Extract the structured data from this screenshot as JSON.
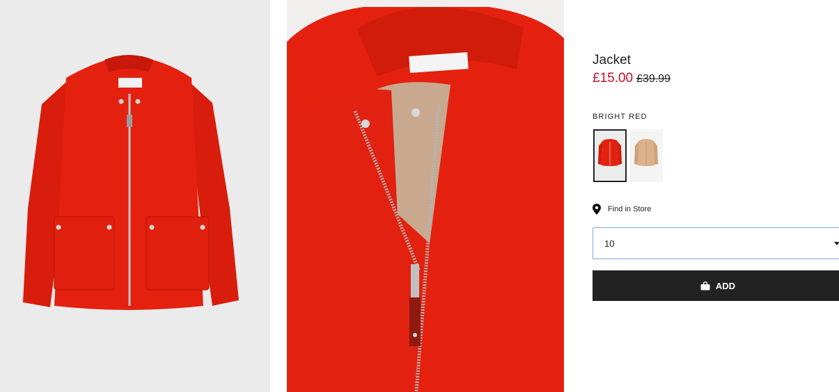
{
  "product": {
    "title": "Jacket",
    "price_sale": "£15.00",
    "price_original": "£39.99",
    "color_name": "BRIGHT RED"
  },
  "swatches": [
    {
      "name": "bright-red",
      "selected": true,
      "color": "#e4210f"
    },
    {
      "name": "beige",
      "selected": false,
      "color": "#d9ae85"
    }
  ],
  "store": {
    "label": "Find in Store",
    "icon": "location-pin-icon"
  },
  "size_select": {
    "value": "10",
    "icon": "chevron-down-icon"
  },
  "add_button": {
    "label": "ADD",
    "icon": "shopping-bag-icon"
  },
  "colors": {
    "sale_price": "#c8102e",
    "jacket_red": "#e4210f",
    "button_bg": "#222222",
    "select_border": "#7aa7e6"
  }
}
